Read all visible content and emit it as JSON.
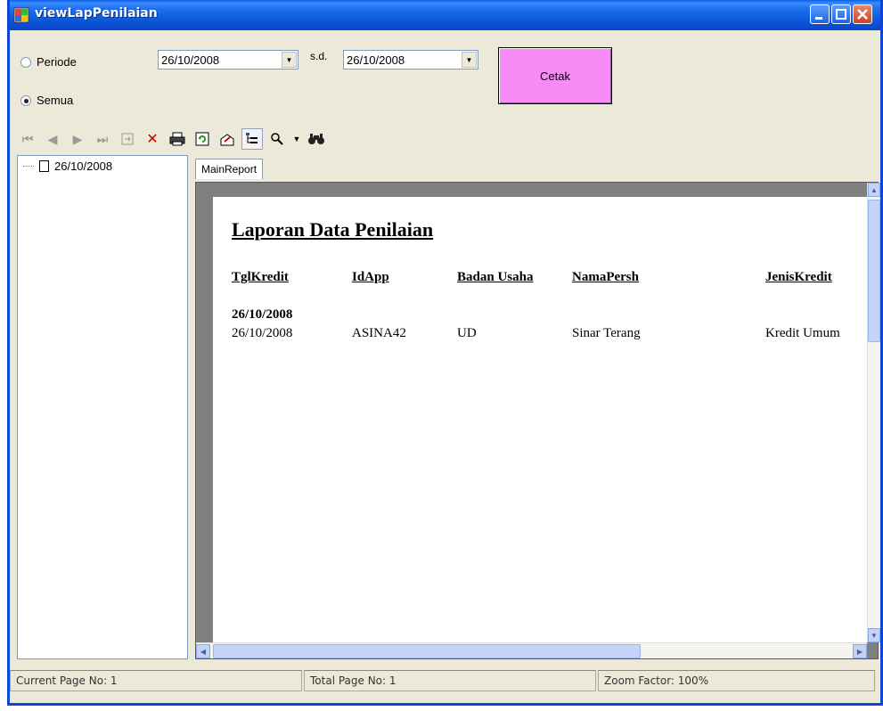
{
  "window": {
    "title": "viewLapPenilaian"
  },
  "options": {
    "radio_periode": "Periode",
    "radio_semua": "Semua",
    "selected": "Semua",
    "date_from": "26/10/2008",
    "date_to": "26/10/2008",
    "sd_label": "s.d.",
    "cetak_label": "Cetak"
  },
  "toolbar": {
    "icons": [
      "first-page-icon",
      "prev-page-icon",
      "next-page-icon",
      "last-page-icon",
      "goto-page-icon",
      "close-view-icon",
      "print-icon",
      "refresh-icon",
      "export-icon",
      "toggle-tree-icon",
      "zoom-icon",
      "zoom-dropdown-icon",
      "search-icon"
    ]
  },
  "tree": {
    "node_label": "26/10/2008"
  },
  "tabs": {
    "main_report": "MainReport"
  },
  "report": {
    "title": "Laporan Data Penilaian",
    "columns": [
      "TglKredit",
      "IdApp",
      "Badan Usaha",
      "NamaPersh",
      "JenisKredit"
    ],
    "group_header": "26/10/2008",
    "rows": [
      [
        "26/10/2008",
        "ASINA42",
        "UD",
        "Sinar Terang",
        "Kredit Umum"
      ]
    ]
  },
  "status": {
    "current_page": "Current Page No: 1",
    "total_page": "Total Page No: 1",
    "zoom": "Zoom Factor: 100%"
  },
  "colors": {
    "titlebar": "#0a55d8",
    "cetak_button": "#f78cf7",
    "close_icon": "#cc0000"
  }
}
